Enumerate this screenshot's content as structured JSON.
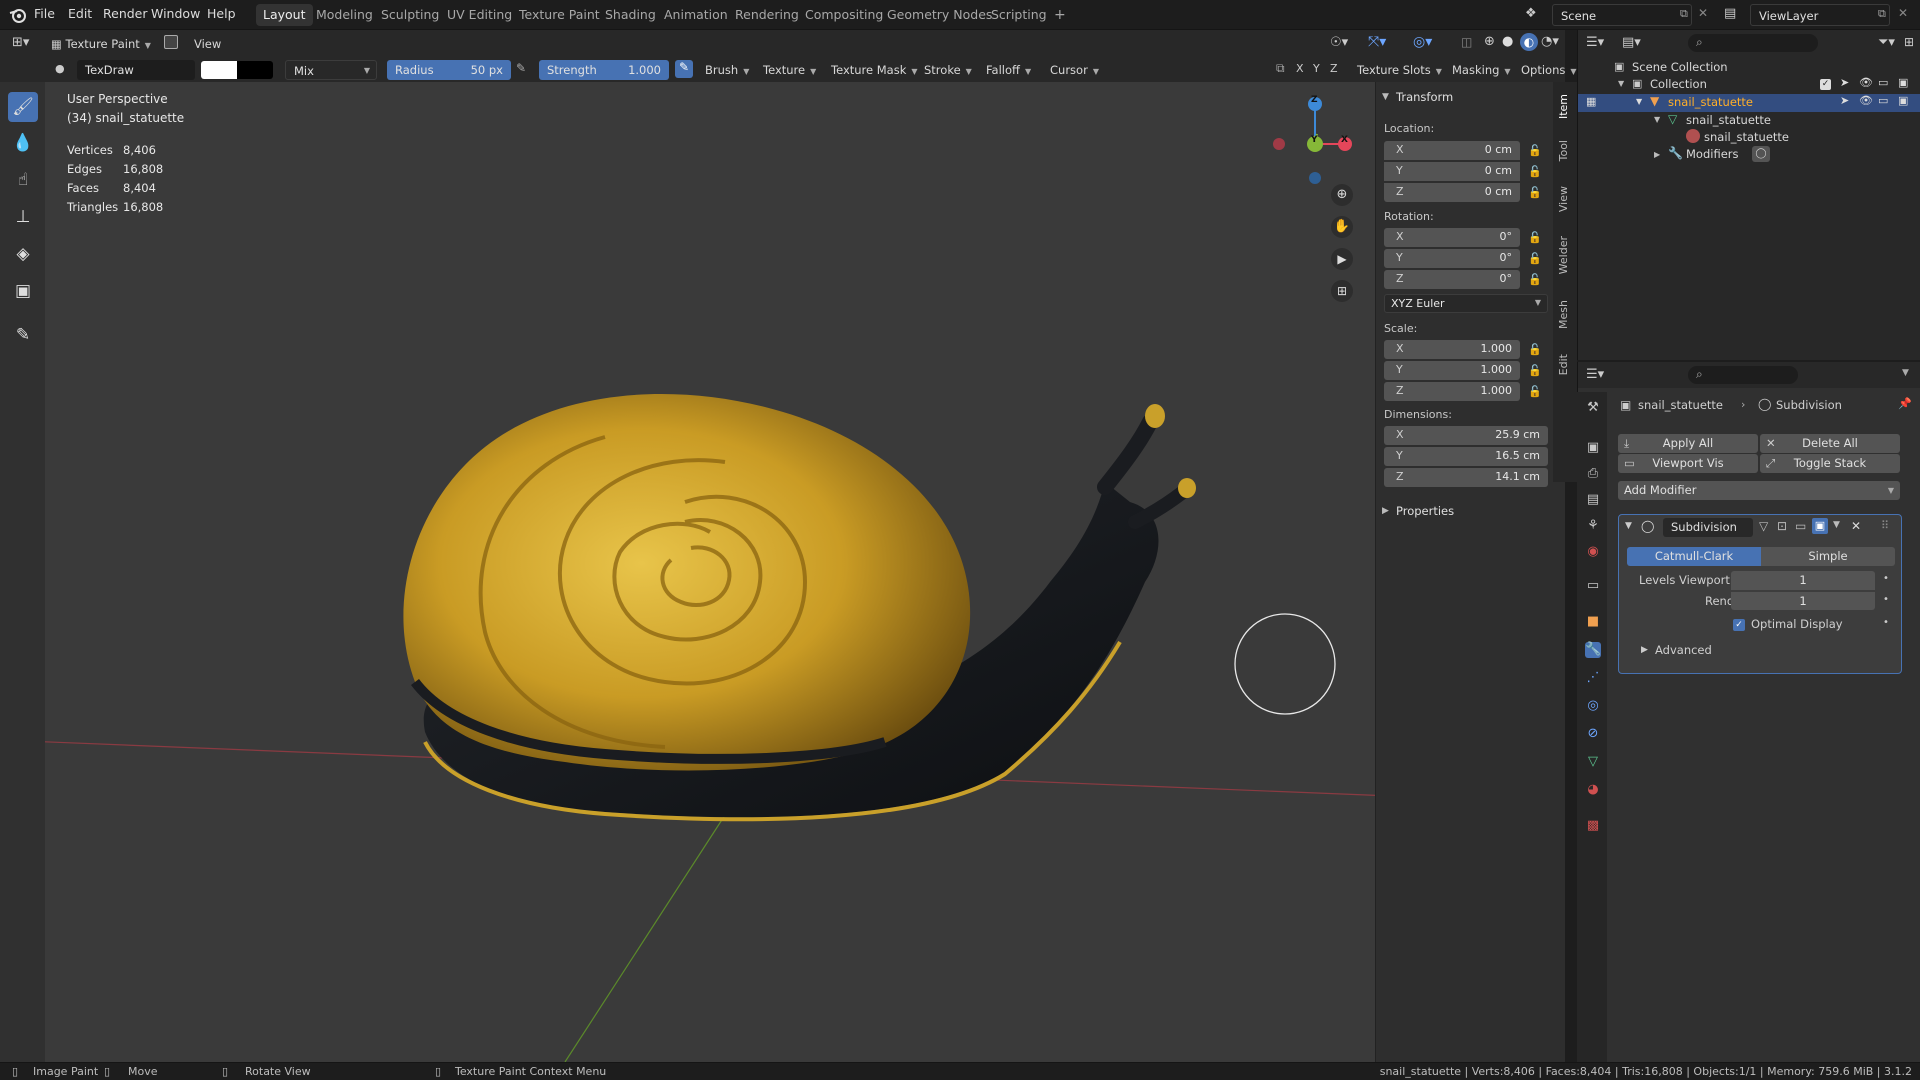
{
  "menubar": {
    "menus": [
      "File",
      "Edit",
      "Render",
      "Window",
      "Help"
    ],
    "workspaces": [
      "Layout",
      "Modeling",
      "Sculpting",
      "UV Editing",
      "Texture Paint",
      "Shading",
      "Animation",
      "Rendering",
      "Compositing",
      "Geometry Nodes",
      "Scripting"
    ],
    "active_workspace": "Layout",
    "add_tab": "+",
    "scene_label": "Scene",
    "viewlayer_label": "ViewLayer"
  },
  "header": {
    "mode": "Texture Paint",
    "view_menu": "View"
  },
  "tool_settings": {
    "brush_name": "TexDraw",
    "blend_mode": "Mix",
    "radius_label": "Radius",
    "radius_value": "50 px",
    "strength_label": "Strength",
    "strength_value": "1.000",
    "menus": [
      "Brush",
      "Texture",
      "Texture Mask",
      "Stroke",
      "Falloff",
      "Cursor"
    ],
    "axes": [
      "X",
      "Y",
      "Z"
    ],
    "texture_slots": "Texture Slots",
    "masking": "Masking",
    "options": "Options"
  },
  "viewport": {
    "perspective": "User Perspective",
    "object_label": "(34) snail_statuette",
    "stats": [
      {
        "label": "Vertices",
        "value": "8,406"
      },
      {
        "label": "Edges",
        "value": "16,808"
      },
      {
        "label": "Faces",
        "value": "8,404"
      },
      {
        "label": "Triangles",
        "value": "16,808"
      }
    ],
    "gizmo_axes": {
      "x": "X",
      "y": "Y",
      "z": "Z"
    },
    "colors": {
      "x_axis": "#e5465a",
      "y_axis": "#86b838",
      "z_axis": "#3d8ad8",
      "bg": "#3a3a3a",
      "gold": "#c9a02a"
    }
  },
  "tools": [
    "draw-brush",
    "soften-brush",
    "smear-brush",
    "clone-brush",
    "fill-brush",
    "mask-brush",
    "annotate"
  ],
  "npanel": {
    "transform_title": "Transform",
    "location_label": "Location:",
    "location": [
      {
        "axis": "X",
        "value": "0 cm"
      },
      {
        "axis": "Y",
        "value": "0 cm"
      },
      {
        "axis": "Z",
        "value": "0 cm"
      }
    ],
    "rotation_label": "Rotation:",
    "rotation": [
      {
        "axis": "X",
        "value": "0°"
      },
      {
        "axis": "Y",
        "value": "0°"
      },
      {
        "axis": "Z",
        "value": "0°"
      }
    ],
    "rotation_mode": "XYZ Euler",
    "scale_label": "Scale:",
    "scale": [
      {
        "axis": "X",
        "value": "1.000"
      },
      {
        "axis": "Y",
        "value": "1.000"
      },
      {
        "axis": "Z",
        "value": "1.000"
      }
    ],
    "dimensions_label": "Dimensions:",
    "dimensions": [
      {
        "axis": "X",
        "value": "25.9 cm"
      },
      {
        "axis": "Y",
        "value": "16.5 cm"
      },
      {
        "axis": "Z",
        "value": "14.1 cm"
      }
    ],
    "properties_title": "Properties",
    "tabs": [
      "Item",
      "Tool",
      "View",
      "Welder",
      "Mesh",
      "Edit"
    ]
  },
  "outliner": {
    "scene_collection": "Scene Collection",
    "collection": "Collection",
    "object": "snail_statuette",
    "mesh": "snail_statuette",
    "material": "snail_statuette",
    "modifiers": "Modifiers"
  },
  "properties": {
    "breadcrumb_object": "snail_statuette",
    "breadcrumb_modifier": "Subdivision",
    "apply_all": "Apply All",
    "delete_all": "Delete All",
    "viewport_vis": "Viewport Vis",
    "toggle_stack": "Toggle Stack",
    "add_modifier": "Add Modifier",
    "modifier_name": "Subdivision",
    "catmull_clark": "Catmull-Clark",
    "simple": "Simple",
    "levels_viewport_label": "Levels Viewport",
    "levels_viewport_value": "1",
    "render_label": "Render",
    "render_value": "1",
    "optimal_display": "Optimal Display",
    "advanced": "Advanced"
  },
  "statusbar": {
    "image_paint": "Image Paint",
    "move": "Move",
    "rotate_view": "Rotate View",
    "context_menu": "Texture Paint Context Menu",
    "info": "snail_statuette | Verts:8,406 | Faces:8,404 | Tris:16,808 | Objects:1/1 | Memory: 759.6 MiB | 3.1.2"
  }
}
